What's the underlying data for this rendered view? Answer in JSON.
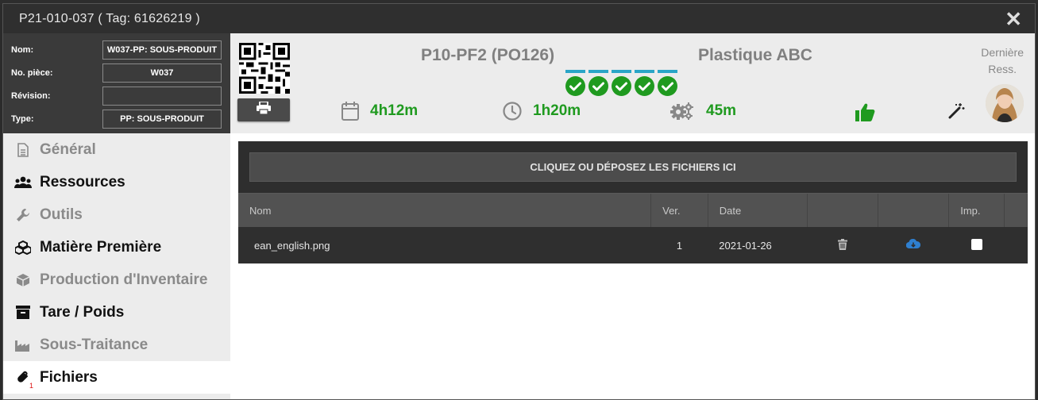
{
  "window": {
    "title": "P21-010-037 ( Tag: 61626219 )",
    "close_label": "✕"
  },
  "properties": [
    {
      "label": "Nom:",
      "value": "W037-PP: SOUS-PRODUIT"
    },
    {
      "label": "No. pièce:",
      "value": "W037"
    },
    {
      "label": "Révision:",
      "value": ""
    },
    {
      "label": "Type:",
      "value": "PP: SOUS-PRODUIT"
    }
  ],
  "nav": [
    {
      "label": "Général",
      "icon": "document-icon"
    },
    {
      "label": "Ressources",
      "icon": "users-icon"
    },
    {
      "label": "Outils",
      "icon": "wrench-icon"
    },
    {
      "label": "Matière Première",
      "icon": "cubes-icon"
    },
    {
      "label": "Production d'Inventaire",
      "icon": "box-icon"
    },
    {
      "label": "Tare / Poids",
      "icon": "archive-icon"
    },
    {
      "label": "Sous-Traitance",
      "icon": "industry-icon"
    },
    {
      "label": "Fichiers",
      "icon": "paperclip-icon",
      "badge": "1"
    }
  ],
  "summary": {
    "code": "P10-PF2 (PO126)",
    "client": "Plastique ABC",
    "last_resource": [
      "Dernière",
      "Ress."
    ],
    "steps_done": 5,
    "metrics": {
      "calendar": "4h12m",
      "clock": "1h20m",
      "gears": "45m"
    }
  },
  "files": {
    "dropzone_label": "CLIQUEZ OU DÉPOSEZ LES FICHIERS ICI",
    "columns": [
      "Nom",
      "Ver.",
      "Date",
      "",
      "",
      "Imp."
    ],
    "rows": [
      {
        "name": "ean_english.png",
        "version": "1",
        "date": "2021-01-26"
      }
    ]
  },
  "colors": {
    "accent_green": "#1f9a1f",
    "step_bar": "#2aa5c7",
    "download_blue": "#2f7fcf"
  }
}
